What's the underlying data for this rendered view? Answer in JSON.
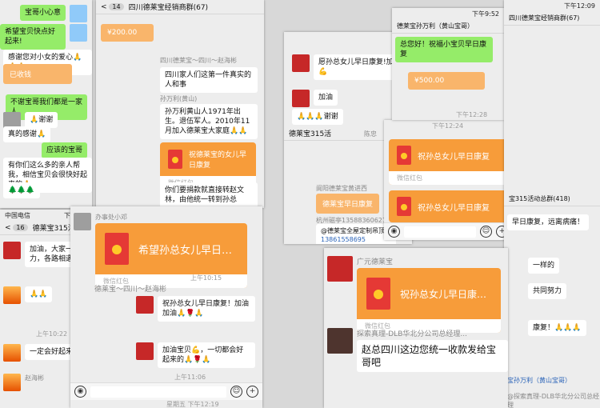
{
  "s1": {
    "m1": "宝哥小心意",
    "m2": "希望宝贝快点好起来!",
    "m3": "感谢您对小女的爱心🙏🙏🙏",
    "m4": "已收钱",
    "m5": "不谢宝哥我们都是一家人",
    "m6": "🙏谢谢",
    "m7": "真的感谢🙏",
    "m8": "应该的宝哥",
    "m9": "有你们这么多的亲人帮我，相信宝贝会很快好起来的🙏",
    "m10": "🌲🌲🌲"
  },
  "s2": {
    "status_carrier": "中国电信",
    "status_time": "下午1:11",
    "back": "16",
    "title": "德莱宝315活",
    "m1": "加油，大家一起努力，各路相遇🙏🙏",
    "m2": "🙏🙏",
    "time": "上午10:22",
    "m3": "一定会好起来的。",
    "sender": "赵海彬"
  },
  "s3": {
    "back": "14",
    "title": "四川德莱宝经销商群(67)",
    "m1": "四川家人们这第一件真实的人和事",
    "m2": "孙万利黄山人1971年出生。退伍军人。2010年11月加入德莱宝大家庭🙏🙏",
    "m3": "你们要捐款就直接转赵文林，由他统一转到孙总",
    "rp": "祝德莱宝的女儿早日康复",
    "rp_label": "微信红包",
    "sender1": "四川德莱宝～四川～赵海彬",
    "sender2": "孙万利(黄山)",
    "amount": "¥200.00"
  },
  "s4": {
    "sender": "办事处小邓",
    "rp": "希望孙总女儿早日…",
    "rp_label": "微信红包",
    "sender2": "德莱宝～四川～赵海彬",
    "m1": "祝孙总女儿早日康复！加油加油🙏🌹🙏",
    "m2": "加油宝贝💪，一切都会好起来的🙏🌹🙏",
    "time1": "上午10:15",
    "time2": "上午11:06",
    "time3": "星期五 下午12:19"
  },
  "s5": {
    "m1": "愿孙总女儿早日康复!加油💪",
    "m2": "加油",
    "m3": "🙏🙏🙏谢谢",
    "title": "德莱宝315活",
    "sender": "陈忠",
    "rp": "祝孙总女儿早日康复",
    "rp_label": "微信红包",
    "sender2": "阆阳德莱宝黄进西",
    "rp2": "德莱宝早日康复",
    "sender3": "杭州磁亭13588360621",
    "link_text": "@德莱宝全屋定制吊顶沈",
    "phone": "13861558695",
    "time": "下午12:24"
  },
  "s6": {
    "status_time": "下午9:52",
    "title": "德莱宝孙万利（黄山宝哥）",
    "m1": "总您好！祝福小宝贝早日康复",
    "amount": "¥500.00",
    "m2": "四川家人们这第一件真实的人和事",
    "m3": "孙万利黄山人1971年出生。退伍军人。2010年11月加入德莱宝大家庭🙏🙏",
    "rp": "祝孙总女儿早日康复",
    "rp_label": "微信红包",
    "time": "下午12:28",
    "rp2": "祝孙总女儿早日康复"
  },
  "s7": {
    "status_time": "下午12:09",
    "title": "四川德莱宝经销商群(67)",
    "title2": "宝315活动总群(418)",
    "m1": "早日康复，远离病痛！",
    "m2": "一样的",
    "m3": "共同努力",
    "m4": "康复！🙏🙏🙏",
    "footer": "宝孙万利（黄山宝哥）",
    "footer2": "@探索真理-DLB华北分公司总经理"
  },
  "s8": {
    "sender": "广元德莱宝",
    "rp": "祝孙总女儿早日康…",
    "rp_label": "微信红包",
    "sender2": "探索真理-DLB华北分公司总经理...",
    "m1": "赵总四川这边您统一收款发给宝哥吧"
  }
}
